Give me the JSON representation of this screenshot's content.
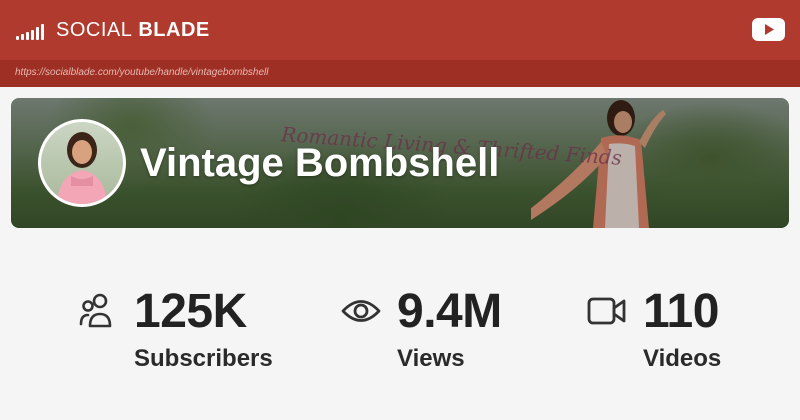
{
  "header": {
    "brand_light": "SOCIAL",
    "brand_bold": "BLADE",
    "url": "https://socialblade.com/youtube/handle/vintagebombshell"
  },
  "banner": {
    "channel_name": "Vintage Bombshell",
    "tagline": "Romantic Living & Thrifted Finds"
  },
  "stats": [
    {
      "value": "125K",
      "label": "Subscribers",
      "icon": "users-icon"
    },
    {
      "value": "9.4M",
      "label": "Views",
      "icon": "eye-icon"
    },
    {
      "value": "110",
      "label": "Videos",
      "icon": "video-camera-icon"
    }
  ],
  "colors": {
    "header_bg": "#b03a2e",
    "url_bar_bg": "#9d2f24",
    "page_bg": "#f5f5f5",
    "text": "#222222"
  }
}
